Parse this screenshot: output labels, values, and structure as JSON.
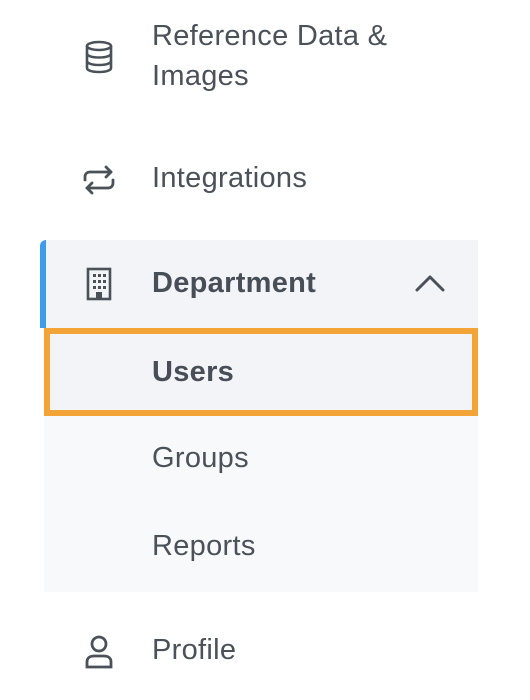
{
  "sidebar": {
    "items": [
      {
        "label": "Reference Data & Images",
        "icon": "database-icon"
      },
      {
        "label": "Integrations",
        "icon": "sync-arrows-icon"
      },
      {
        "label": "Department",
        "icon": "building-icon",
        "expanded": true,
        "children": [
          {
            "label": "Users",
            "selected": true
          },
          {
            "label": "Groups"
          },
          {
            "label": "Reports"
          }
        ]
      },
      {
        "label": "Profile",
        "icon": "user-icon"
      }
    ]
  },
  "colors": {
    "text": "#4a5159",
    "active_indicator": "#3d9be9",
    "highlight_outline": "#f2a536",
    "active_background": "#f2f4f7",
    "submenu_background": "#f8f9fb"
  }
}
